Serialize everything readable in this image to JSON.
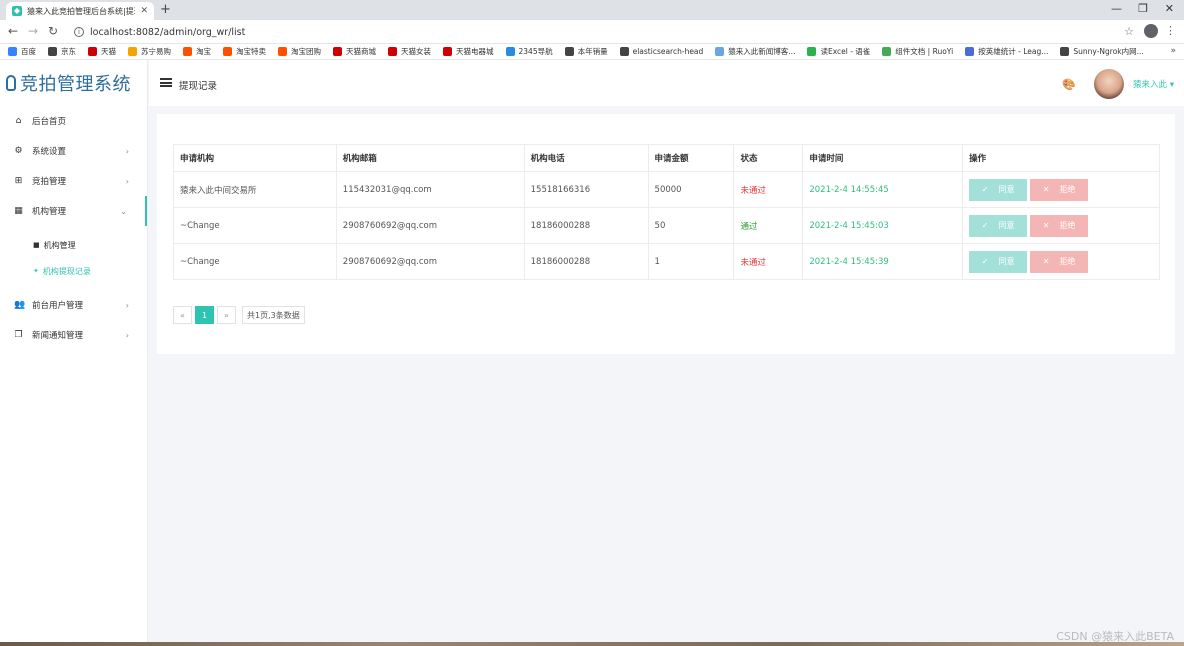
{
  "browser": {
    "tab_title": "猿来入此竞拍管理后台系统|提现...",
    "new_tab": "+",
    "url": "localhost:8082/admin/org_wr/list",
    "bookmarks": [
      {
        "label": "百度",
        "color": "#3385ff"
      },
      {
        "label": "京东",
        "color": "#444444"
      },
      {
        "label": "天猫",
        "color": "#d00000"
      },
      {
        "label": "苏宁易购",
        "color": "#f5a400"
      },
      {
        "label": "淘宝",
        "color": "#ff5000"
      },
      {
        "label": "淘宝特卖",
        "color": "#ff5000"
      },
      {
        "label": "淘宝团购",
        "color": "#ff5000"
      },
      {
        "label": "天猫商城",
        "color": "#d00000"
      },
      {
        "label": "天猫女装",
        "color": "#d00000"
      },
      {
        "label": "天猫电器城",
        "color": "#d00000"
      },
      {
        "label": "2345导航",
        "color": "#2a8ae0"
      },
      {
        "label": "本年销量",
        "color": "#444444"
      },
      {
        "label": "elasticsearch-head",
        "color": "#444444"
      },
      {
        "label": "猿来入此新闻博客...",
        "color": "#6aa7e0"
      },
      {
        "label": "读Excel - 语雀",
        "color": "#2bb24c"
      },
      {
        "label": "组件文档 | RuoYi",
        "color": "#44aa55"
      },
      {
        "label": "按英雄统计 - Leag...",
        "color": "#4b6bd6"
      },
      {
        "label": "Sunny-Ngrok内网...",
        "color": "#444444"
      }
    ],
    "bookmarks_more": "»"
  },
  "sidebar": {
    "logo": "竞拍管理系统",
    "items": [
      {
        "label": "后台首页",
        "icon": "home-icon",
        "glyph": "⌂",
        "arrow": ""
      },
      {
        "label": "系统设置",
        "icon": "gear-icon",
        "glyph": "⚙",
        "arrow": "›"
      },
      {
        "label": "竞拍管理",
        "icon": "auction-icon",
        "glyph": "⊞",
        "arrow": "›"
      },
      {
        "label": "机构管理",
        "icon": "grid-icon",
        "glyph": "▦",
        "arrow": "⌄"
      },
      {
        "label": "前台用户管理",
        "icon": "users-icon",
        "glyph": "👥",
        "arrow": "›"
      },
      {
        "label": "新闻通知管理",
        "icon": "copy-icon",
        "glyph": "❐",
        "arrow": "›"
      }
    ],
    "subitems": [
      {
        "label": "机构管理",
        "glyph": "■"
      },
      {
        "label": "机构提现记录",
        "glyph": "✦"
      }
    ]
  },
  "header": {
    "title": "提现记录",
    "username": "猿来入此",
    "username_caret": "▾"
  },
  "table": {
    "columns": [
      "申请机构",
      "机构邮箱",
      "机构电话",
      "申请金额",
      "状态",
      "申请时间",
      "操作"
    ],
    "rows": [
      {
        "org": "猿来入此中间交易所",
        "email": "115432031@qq.com",
        "phone": "15518166316",
        "amount": "50000",
        "status": "未通过",
        "time": "2021-2-4 14:55:45"
      },
      {
        "org": "~Change",
        "email": "2908760692@qq.com",
        "phone": "18186000288",
        "amount": "50",
        "status": "通过",
        "time": "2021-2-4 15:45:03"
      },
      {
        "org": "~Change",
        "email": "2908760692@qq.com",
        "phone": "18186000288",
        "amount": "1",
        "status": "未通过",
        "time": "2021-2-4 15:45:39"
      }
    ],
    "agree_label": "同意",
    "refuse_label": "拒绝"
  },
  "pager": {
    "prev": "«",
    "current": "1",
    "next": "»",
    "info": "共1页,3条数据"
  },
  "watermark": "CSDN @猿来入此BETA",
  "colors": {
    "accent": "#2fc4b2",
    "fail": "#e33333",
    "ok": "#2b9d32",
    "time": "#2fbf7d"
  }
}
